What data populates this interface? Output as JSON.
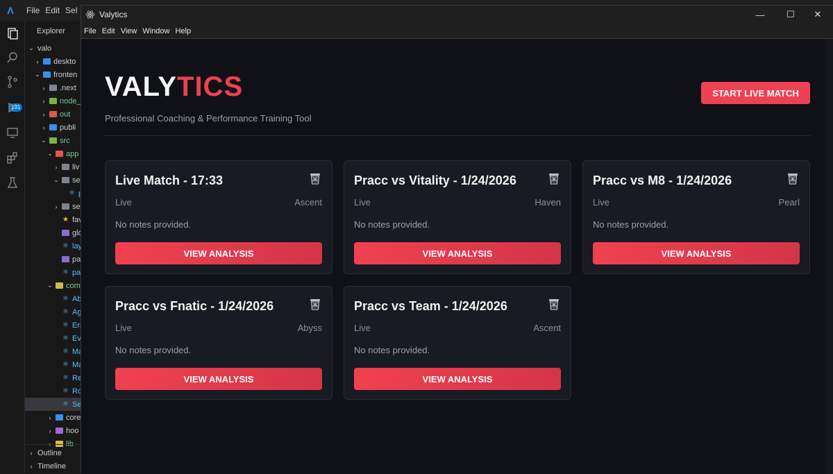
{
  "ide": {
    "menu": [
      "File",
      "Edit",
      "Sel"
    ],
    "explorer_title": "Explorer",
    "scm_badge": "191",
    "tree": [
      {
        "label": "valo",
        "chev": "v",
        "indent": 0,
        "type": "none"
      },
      {
        "label": "deskto",
        "chev": ">",
        "indent": 1,
        "type": "folder-blue"
      },
      {
        "label": "fronten",
        "chev": "v",
        "indent": 1,
        "type": "folder-blue"
      },
      {
        "label": ".next",
        "chev": ">",
        "indent": 2,
        "type": "folder-gray"
      },
      {
        "label": "node_",
        "chev": ">",
        "indent": 2,
        "type": "folder-green"
      },
      {
        "label": "out",
        "chev": ">",
        "indent": 2,
        "type": "folder-red"
      },
      {
        "label": "publi",
        "chev": ">",
        "indent": 2,
        "type": "folder-blue"
      },
      {
        "label": "src",
        "chev": "v",
        "indent": 2,
        "type": "folder-green"
      },
      {
        "label": "app",
        "chev": "v",
        "indent": 3,
        "type": "folder-red"
      },
      {
        "label": "liv",
        "chev": ">",
        "indent": 4,
        "type": "folder-gray"
      },
      {
        "label": "se",
        "chev": "v",
        "indent": 4,
        "type": "folder-gray"
      },
      {
        "label": "p",
        "chev": "",
        "indent": 5,
        "type": "react"
      },
      {
        "label": "se",
        "chev": ">",
        "indent": 4,
        "type": "folder-gray"
      },
      {
        "label": "fav",
        "chev": "",
        "indent": 4,
        "type": "star"
      },
      {
        "label": "glo",
        "chev": "",
        "indent": 4,
        "type": "file-purple"
      },
      {
        "label": "lay",
        "chev": "",
        "indent": 4,
        "type": "react"
      },
      {
        "label": "pa",
        "chev": "",
        "indent": 4,
        "type": "file-purple"
      },
      {
        "label": "pa",
        "chev": "",
        "indent": 4,
        "type": "react"
      },
      {
        "label": "com",
        "chev": "v",
        "indent": 3,
        "type": "folder-yellow"
      },
      {
        "label": "Ab",
        "chev": "",
        "indent": 4,
        "type": "react"
      },
      {
        "label": "Ag",
        "chev": "",
        "indent": 4,
        "type": "react"
      },
      {
        "label": "Err",
        "chev": "",
        "indent": 4,
        "type": "react"
      },
      {
        "label": "Ev",
        "chev": "",
        "indent": 4,
        "type": "react"
      },
      {
        "label": "Ma",
        "chev": "",
        "indent": 4,
        "type": "react"
      },
      {
        "label": "Ma",
        "chev": "",
        "indent": 4,
        "type": "react"
      },
      {
        "label": "Re",
        "chev": "",
        "indent": 4,
        "type": "react"
      },
      {
        "label": "Ro",
        "chev": "",
        "indent": 4,
        "type": "react"
      },
      {
        "label": "Se",
        "chev": "",
        "indent": 4,
        "type": "react"
      },
      {
        "label": "core",
        "chev": ">",
        "indent": 3,
        "type": "folder-blue"
      },
      {
        "label": "hoo",
        "chev": ">",
        "indent": 3,
        "type": "folder-purple"
      },
      {
        "label": "lib",
        "chev": ">",
        "indent": 3,
        "type": "folder-yellow"
      }
    ],
    "outline_label": "Outline",
    "timeline_label": "Timeline"
  },
  "window": {
    "title": "Valytics",
    "menu": [
      "File",
      "Edit",
      "View",
      "Window",
      "Help"
    ],
    "controls": {
      "minimize": "—",
      "maximize": "☐",
      "close": "✕"
    }
  },
  "app": {
    "brand_part1": "VALY",
    "brand_part2": "TICS",
    "tagline": "Professional Coaching & Performance Training Tool",
    "start_button": "START LIVE MATCH",
    "accent_color": "#ee4254",
    "matches": [
      {
        "title": "Live Match - 17:33",
        "status": "Live",
        "map": "Ascent",
        "notes": "No notes provided.",
        "button": "VIEW ANALYSIS"
      },
      {
        "title": "Pracc vs Vitality - 1/24/2026",
        "status": "Live",
        "map": "Haven",
        "notes": "No notes provided.",
        "button": "VIEW ANALYSIS"
      },
      {
        "title": "Pracc vs M8 - 1/24/2026",
        "status": "Live",
        "map": "Pearl",
        "notes": "No notes provided.",
        "button": "VIEW ANALYSIS"
      },
      {
        "title": "Pracc vs Fnatic - 1/24/2026",
        "status": "Live",
        "map": "Abyss",
        "notes": "No notes provided.",
        "button": "VIEW ANALYSIS"
      },
      {
        "title": "Pracc vs Team - 1/24/2026",
        "status": "Live",
        "map": "Ascent",
        "notes": "No notes provided.",
        "button": "VIEW ANALYSIS"
      }
    ]
  }
}
